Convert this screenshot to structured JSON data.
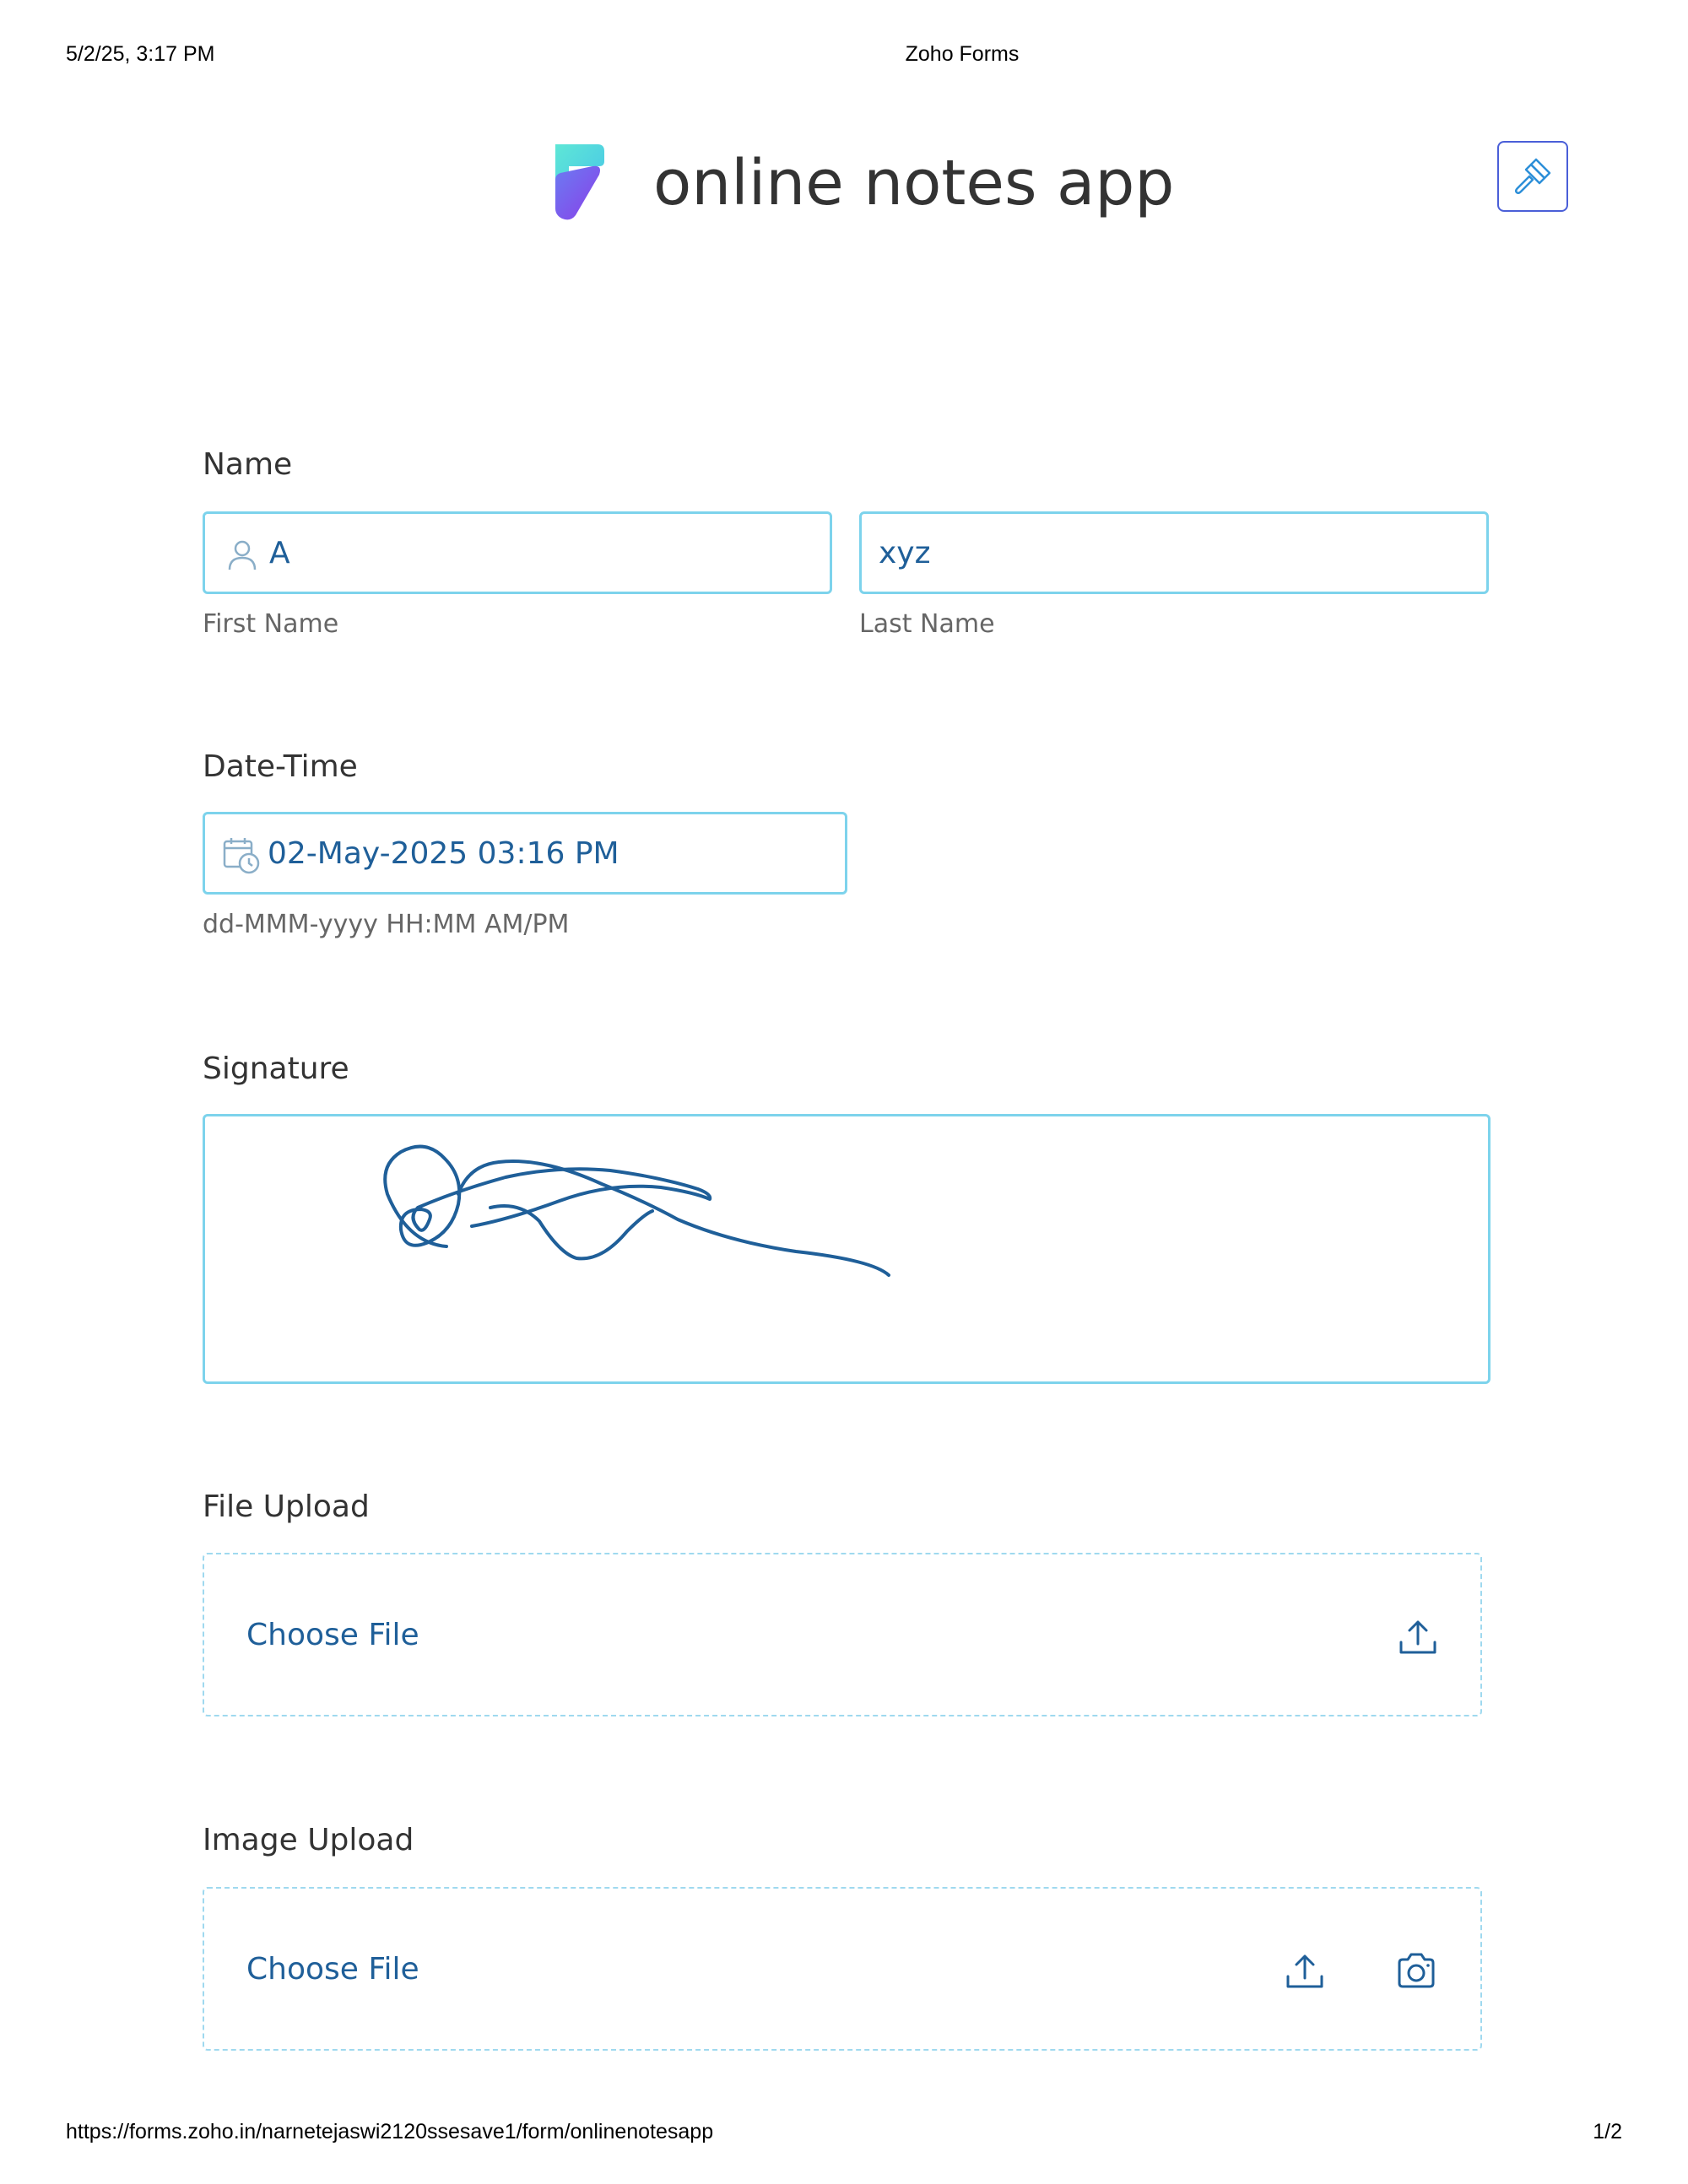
{
  "print_header": {
    "datetime": "5/2/25, 3:17 PM",
    "page_title": "Zoho Forms"
  },
  "form": {
    "title": "online notes app",
    "theme_icon": "paintbrush-icon",
    "logo_icon": "zoho-forms-logo"
  },
  "name_field": {
    "label": "Name",
    "first_name_value": "A",
    "first_name_helper": "First Name",
    "last_name_value": "xyz",
    "last_name_helper": "Last Name",
    "icon": "user-icon"
  },
  "datetime_field": {
    "label": "Date-Time",
    "value": "02-May-2025 03:16 PM",
    "helper": "dd-MMM-yyyy HH:MM AM/PM",
    "icon": "calendar-clock-icon"
  },
  "signature_field": {
    "label": "Signature"
  },
  "file_upload": {
    "label": "File Upload",
    "choose_label": "Choose File",
    "icon": "upload-icon"
  },
  "image_upload": {
    "label": "Image Upload",
    "choose_label": "Choose File",
    "icons": [
      "upload-icon",
      "camera-icon"
    ]
  },
  "print_footer": {
    "url": "https://forms.zoho.in/narnetejaswi2120ssesave1/form/onlinenotesapp",
    "page_number": "1/2"
  },
  "colors": {
    "input_border": "#7dd3ec",
    "input_text": "#1f5f99",
    "signature_ink": "#1f5f99",
    "theme_button_border": "#4a5fd8"
  }
}
